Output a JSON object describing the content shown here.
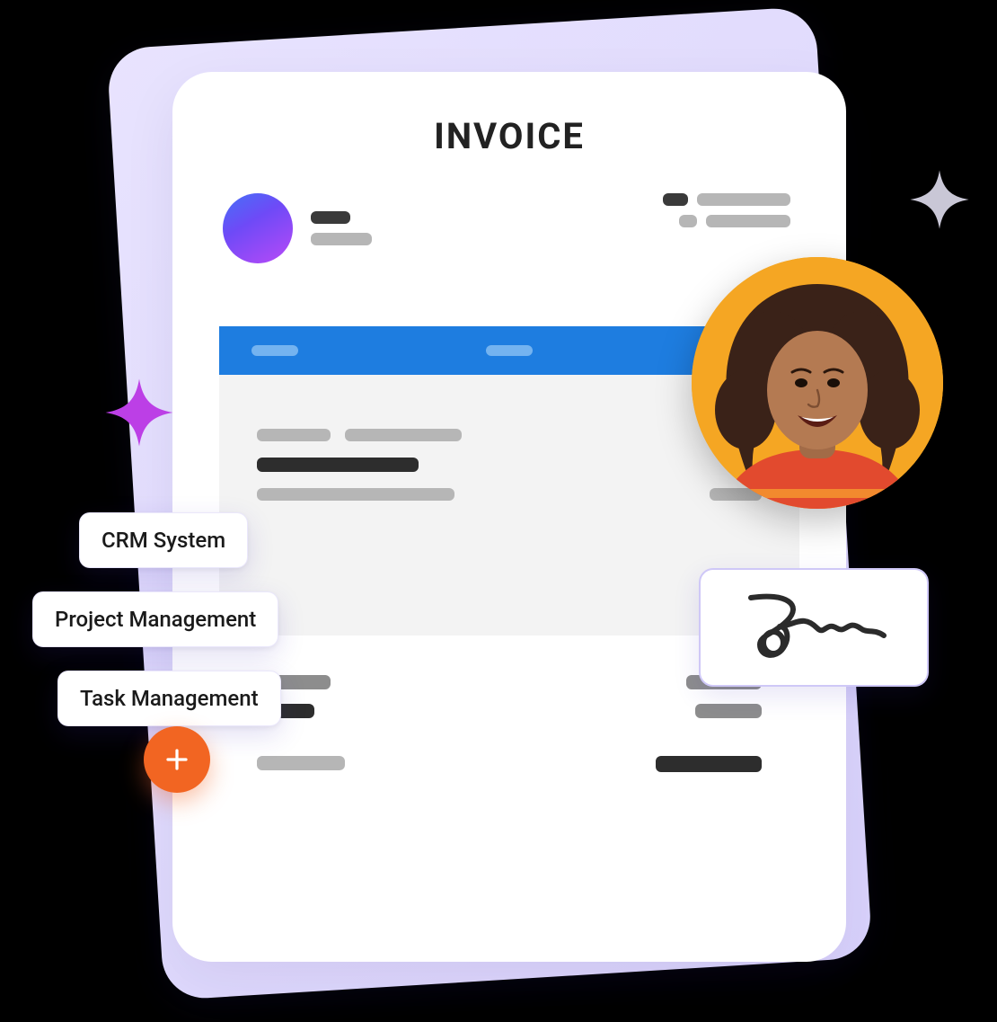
{
  "invoice": {
    "title": "INVOICE"
  },
  "tags": {
    "t1": "CRM System",
    "t2": "Project Management",
    "t3": "Task Management"
  },
  "colors": {
    "accent_blue": "#1E7DE0",
    "accent_orange": "#F26522",
    "accent_purple": "#B24AF7",
    "back_card": "#E0DAFB"
  },
  "icons": {
    "plus": "plus-icon",
    "sparkle_purple": "sparkle-icon",
    "sparkle_grey": "sparkle-icon",
    "signature": "signature-icon",
    "avatar": "person-avatar"
  }
}
